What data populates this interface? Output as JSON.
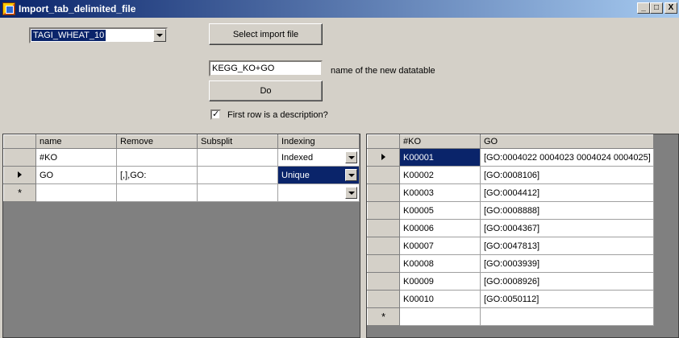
{
  "window": {
    "title": "Import_tab_delimited_file",
    "minimize_label": "_",
    "maximize_label": "□",
    "close_label": "X"
  },
  "source_combo": {
    "value": "TAGI_WHEAT_10"
  },
  "buttons": {
    "select_import": "Select import file",
    "do": "Do"
  },
  "datatable_name": {
    "value": "KEGG_KO+GO",
    "label": "name of the new datatable"
  },
  "first_row_checkbox": {
    "checked": true,
    "mark": "✓",
    "label": "First row is a description?"
  },
  "left_grid": {
    "columns": [
      "name",
      "Remove",
      "Subsplit",
      "Indexing"
    ],
    "rows": [
      {
        "name": "#KO",
        "remove": "",
        "subsplit": "",
        "indexing": "Indexed"
      },
      {
        "name": "GO",
        "remove": "[,],GO:",
        "subsplit": "",
        "indexing": "Unique"
      }
    ],
    "new_row_marker": "*"
  },
  "right_grid": {
    "columns": [
      "#KO",
      "GO"
    ],
    "rows": [
      {
        "ko": "K00001",
        "go": "[GO:0004022 0004023 0004024 0004025]"
      },
      {
        "ko": "K00002",
        "go": "[GO:0008106]"
      },
      {
        "ko": "K00003",
        "go": "[GO:0004412]"
      },
      {
        "ko": "K00005",
        "go": "[GO:0008888]"
      },
      {
        "ko": "K00006",
        "go": "[GO:0004367]"
      },
      {
        "ko": "K00007",
        "go": "[GO:0047813]"
      },
      {
        "ko": "K00008",
        "go": "[GO:0003939]"
      },
      {
        "ko": "K00009",
        "go": "[GO:0008926]"
      },
      {
        "ko": "K00010",
        "go": "[GO:0050112]"
      }
    ],
    "new_row_marker": "*"
  }
}
